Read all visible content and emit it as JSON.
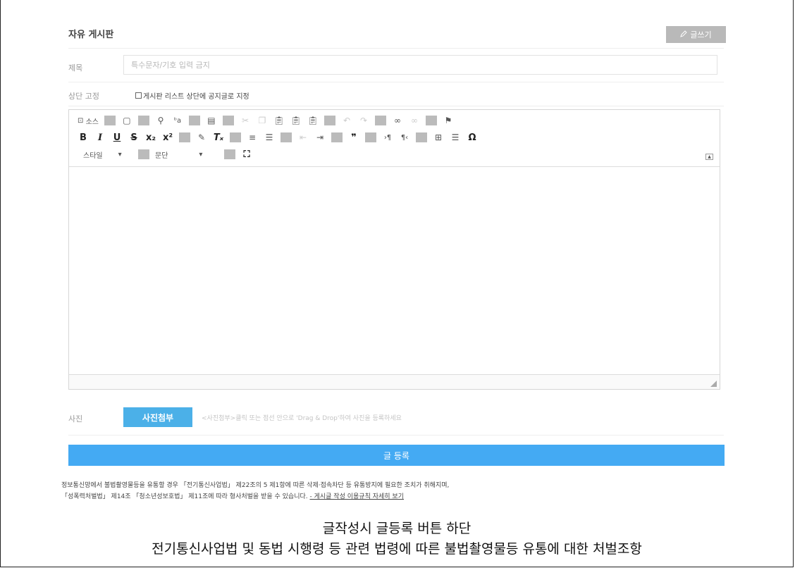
{
  "board": {
    "title": "자유 게시판",
    "write_button": "글쓰기",
    "write_icon": "pencil-icon"
  },
  "form": {
    "title_label": "제목",
    "title_placeholder": "특수문자/기호 입력 금지",
    "pin_label": "상단 고정",
    "pin_checkbox_label": "게시판 리스트 상단에 공지글로 지정",
    "photo_label": "사진",
    "photo_button": "사진첨부",
    "photo_hint": "<사진첨부>클릭 또는 점선 안으로 'Drag & Drop'하여 사진을 등록하세요",
    "submit_button": "글 등록"
  },
  "editor": {
    "source_label": "소스",
    "style_select": "스타일",
    "paragraph_select": "문단"
  },
  "notice": {
    "line1": "정보통신망에서 불법촬영물등을 유통할 경우 「전기통신사업법」 제22조의 5 제1항에 따른 삭제·접속차단 등 유통방지에 필요한 조치가 취해지며,",
    "line2": "「성폭력처벌법」 제14조 「청소년성보호법」 제11조에 따라 형사처벌을 받을 수 있습니다.",
    "link": "- 게시글 작성 이용규칙 자세히 보기"
  },
  "caption": {
    "line1": "글작성시 글등록 버튼 하단",
    "line2": "전기통신사업법 및 동법 시행령 등 관련 법령에 따른 불법촬영물등 유통에 대한 처벌조항"
  },
  "colors": {
    "accent": "#44aaf3",
    "photo_button": "#4bb0e8",
    "write_button": "#b9b9b9"
  }
}
